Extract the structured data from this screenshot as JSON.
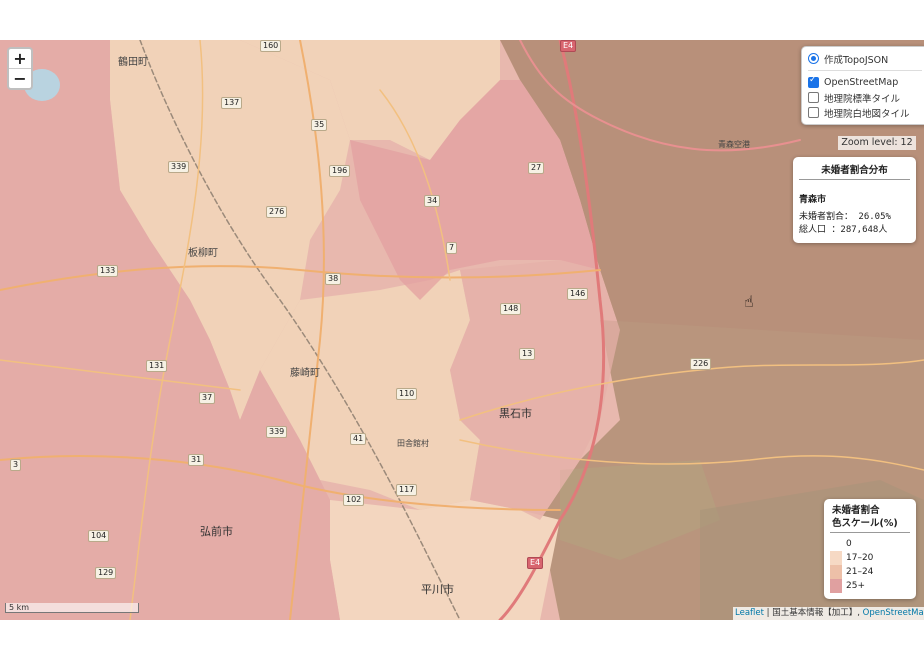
{
  "map": {
    "labels": {
      "tsuruta": "鶴田町",
      "itayanagi": "板柳町",
      "fujisaki": "藤崎町",
      "kuroishi": "黒石市",
      "inakadate": "田舎館村",
      "hirosaki": "弘前市",
      "hirakawa": "平川市",
      "airport": "青森空港"
    },
    "routes": [
      "160",
      "137",
      "35",
      "339",
      "196",
      "276",
      "34",
      "27",
      "7",
      "133",
      "38",
      "148",
      "146",
      "13",
      "226",
      "131",
      "37",
      "110",
      "339",
      "41",
      "31",
      "102",
      "117",
      "3",
      "104",
      "129",
      "E4",
      "E4"
    ]
  },
  "controls": {
    "zoom_in": "+",
    "zoom_out": "−"
  },
  "layers": {
    "base": "作成TopoJSON",
    "overlay1": "OpenStreetMap",
    "overlay2": "地理院標準タイル",
    "overlay3": "地理院白地図タイル"
  },
  "zoom_level": "Zoom level: 12",
  "info": {
    "title": "未婚者割合分布",
    "city": "青森市",
    "rate_line": "未婚者割合：  26.05%",
    "pop_line": "総人口    ：287,648人"
  },
  "legend": {
    "title1": "未婚者割合",
    "title2": "色スケール(%)",
    "items": [
      {
        "label": "0",
        "color": "#ffffff"
      },
      {
        "label": "17–20",
        "color": "#f6d9c4"
      },
      {
        "label": "21–24",
        "color": "#edc0a8"
      },
      {
        "label": "25+",
        "color": "#e0a0a0"
      }
    ]
  },
  "scale": "5 km",
  "attribution": {
    "leaflet": "Leaflet",
    "gsi": " | 国土基本情報【加工】, ",
    "osm": "OpenStreetMap"
  }
}
